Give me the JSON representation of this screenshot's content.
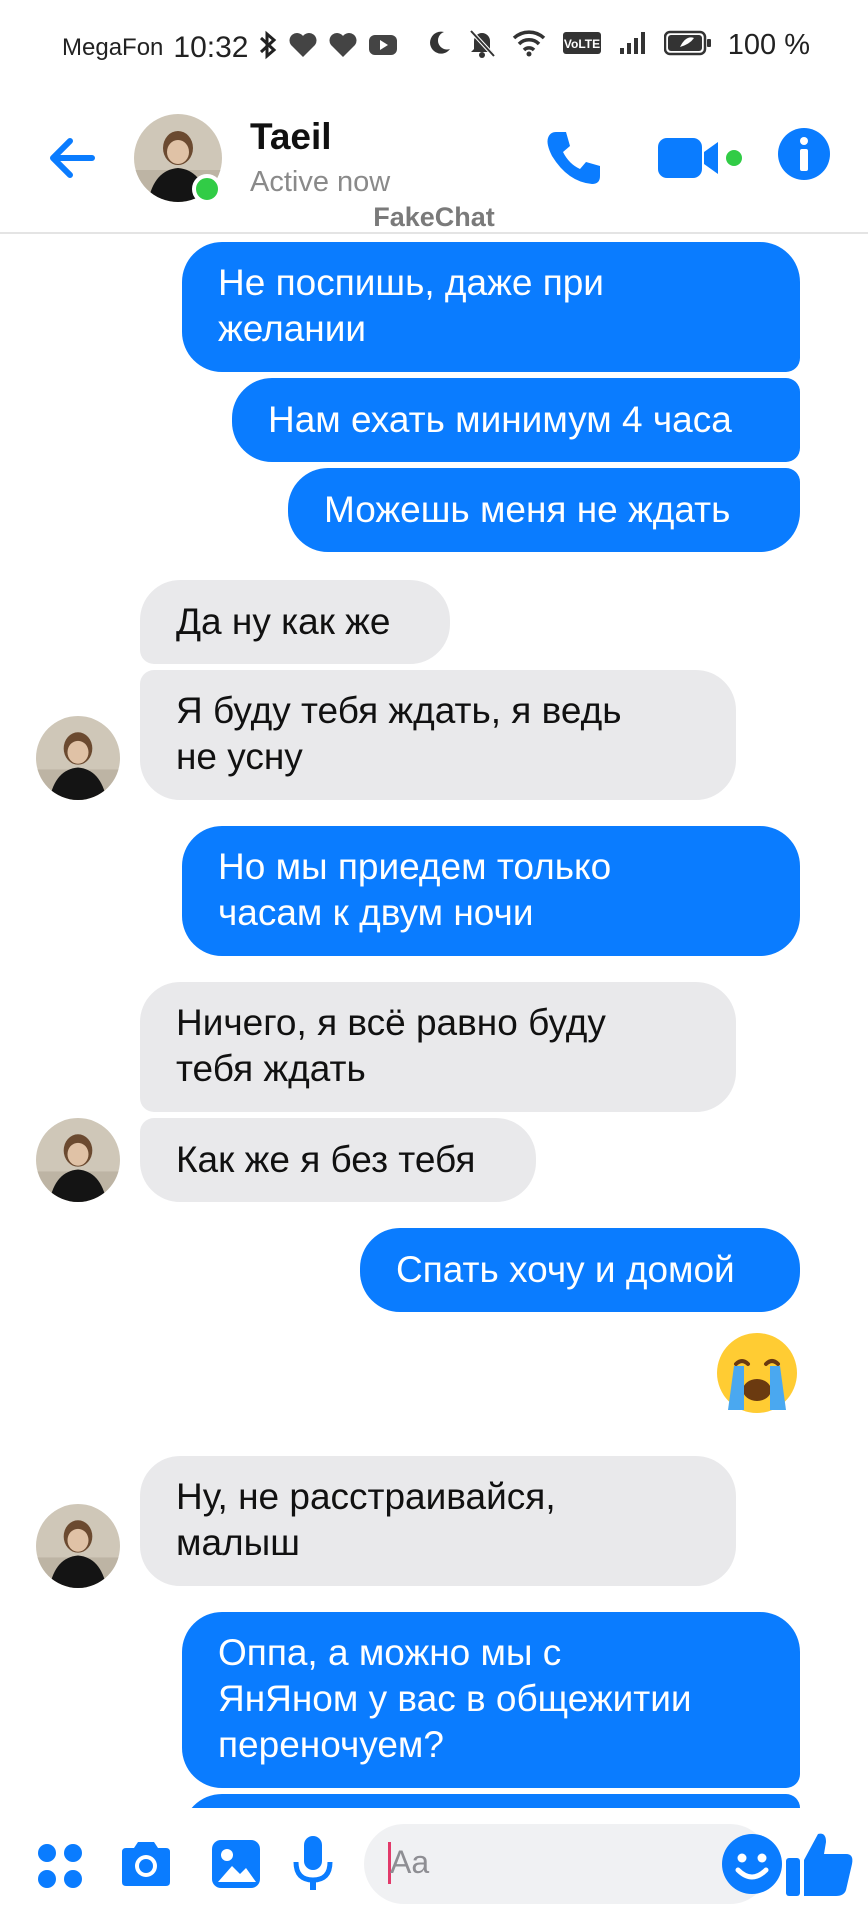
{
  "status_bar": {
    "carrier": "MegaFon",
    "time": "10:32",
    "battery": "100 %",
    "network_badge": "VoLTE"
  },
  "header": {
    "name": "Taeil",
    "status": "Active now",
    "watermark": "FakeChat"
  },
  "messages": [
    {
      "side": "out",
      "lines": [
        "Не поспишь, даже при",
        "желании"
      ]
    },
    {
      "side": "out",
      "lines": [
        "Нам ехать минимум 4 часа"
      ]
    },
    {
      "side": "out",
      "lines": [
        "Можешь меня не ждать"
      ]
    },
    {
      "side": "in",
      "lines": [
        "Да ну как же"
      ]
    },
    {
      "side": "in",
      "lines": [
        "Я буду тебя ждать, я ведь",
        "не усну"
      ]
    },
    {
      "side": "out",
      "lines": [
        "Но мы приедем только",
        "часам к двум ночи"
      ]
    },
    {
      "side": "in",
      "lines": [
        "Ничего, я всё равно буду",
        "тебя ждать"
      ]
    },
    {
      "side": "in",
      "lines": [
        "Как же я без тебя"
      ]
    },
    {
      "side": "out",
      "lines": [
        "Спать хочу и домой"
      ]
    },
    {
      "side": "out",
      "emoji": "loudly-crying-face"
    },
    {
      "side": "in",
      "lines": [
        "Ну, не расстраивайся,",
        "малыш"
      ]
    },
    {
      "side": "out",
      "lines": [
        "Оппа, а можно мы с",
        "ЯнЯном у вас в общежитии",
        "переночуем?"
      ]
    }
  ],
  "composer": {
    "placeholder": "Aa"
  },
  "colors": {
    "accent": "#0a7cff",
    "incoming_bubble": "#e9e9eb",
    "online": "#31cc46"
  }
}
